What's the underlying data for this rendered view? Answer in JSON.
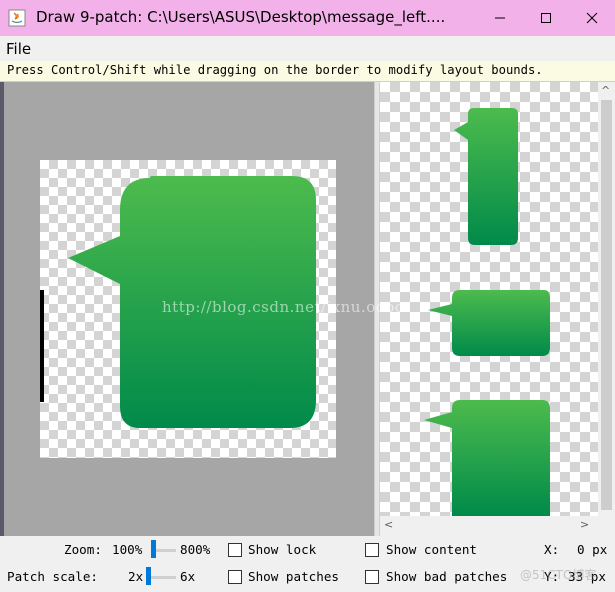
{
  "window": {
    "title": "Draw 9-patch: C:\\Users\\ASUS\\Desktop\\message_left....",
    "minimize_icon": "minimize-icon",
    "maximize_icon": "maximize-icon",
    "close_icon": "close-icon"
  },
  "menu": {
    "file_label": "File"
  },
  "hint": {
    "text": "Press Control/Shift while dragging on the border to modify layout bounds."
  },
  "colors": {
    "titlebar": "#f2b1e8",
    "bubble_top": "#4dbb4d",
    "bubble_bottom": "#008a4a",
    "editor_bg": "#a6a6a6",
    "slider_accent": "#0078d7"
  },
  "status": {
    "zoom_label": "Zoom:",
    "zoom_min": "100%",
    "zoom_max": "800%",
    "zoom_value": 0.0,
    "patch_scale_label": "Patch scale:",
    "patch_scale_min": "2x",
    "patch_scale_max": "6x",
    "patch_scale_value": 0.0,
    "show_lock": "Show lock",
    "show_patches": "Show patches",
    "show_content": "Show content",
    "show_bad_patches": "Show bad patches",
    "x_label": "X:",
    "x_value": "0 px",
    "y_label": "Y:",
    "y_value": "33 px"
  },
  "watermarks": {
    "blog": "http://blog.csdn.net/jxnu.oooo",
    "corner": "@51CTO博客"
  }
}
